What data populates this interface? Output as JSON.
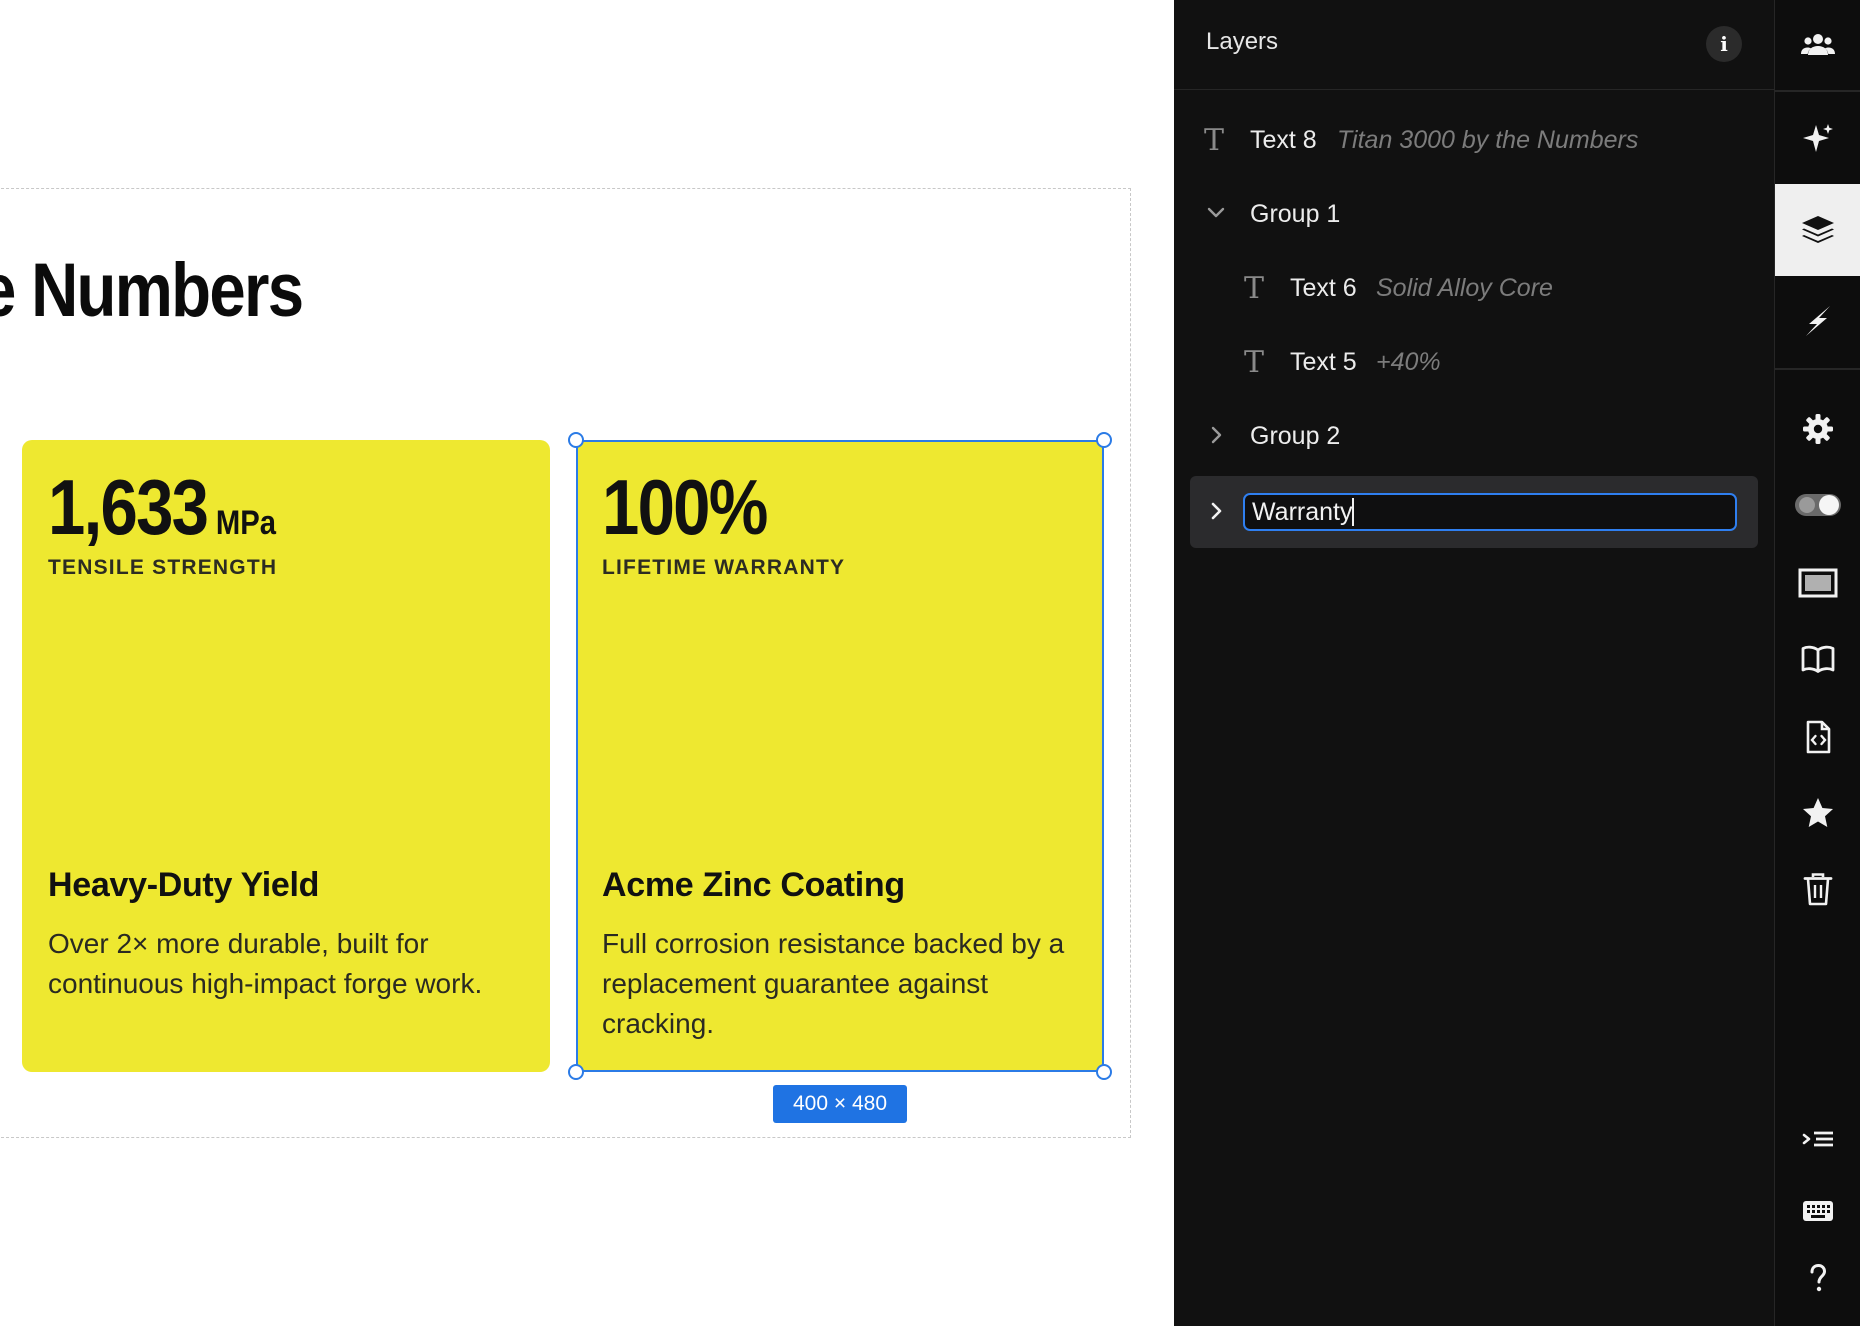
{
  "canvas": {
    "heading_text": "e Numbers",
    "cards": [
      {
        "stat_value": "1,633",
        "stat_unit": "MPa",
        "stat_label": "TENSILE STRENGTH",
        "title": "Heavy-Duty Yield",
        "body": "Over 2× more durable, built for continuous high-impact forge work."
      },
      {
        "stat_value": "100%",
        "stat_unit": "",
        "stat_label": "LIFETIME WARRANTY",
        "title": "Acme Zinc Coating",
        "body": "Full corrosion resistance backed by a replacement guarantee against cracking."
      }
    ],
    "selection_size": "400 × 480",
    "card_color": "#eee830",
    "selection_color": "#2b7be6"
  },
  "layers_panel": {
    "title": "Layers",
    "info_icon": "info-icon",
    "layers": [
      {
        "name": "Text 8",
        "preview": "Titan 3000 by the Numbers",
        "type": "text"
      },
      {
        "name": "Group 1",
        "type": "group",
        "expanded": true
      },
      {
        "name": "Text 6",
        "preview": "Solid Alloy Core",
        "type": "text"
      },
      {
        "name": "Text 5",
        "preview": "+40%",
        "type": "text"
      },
      {
        "name": "Group 2",
        "type": "group",
        "expanded": false
      }
    ],
    "rename_value": "Warranty"
  },
  "toolbar": {
    "icons": [
      "users-icon",
      "sparkle-icon",
      "layers-icon",
      "lightning-icon",
      "gear-icon",
      "toggle-icon",
      "frame-icon",
      "book-icon",
      "code-file-icon",
      "star-icon",
      "trash-icon",
      "indent-list-icon",
      "keyboard-icon",
      "help-icon"
    ],
    "active": "layers-icon"
  }
}
